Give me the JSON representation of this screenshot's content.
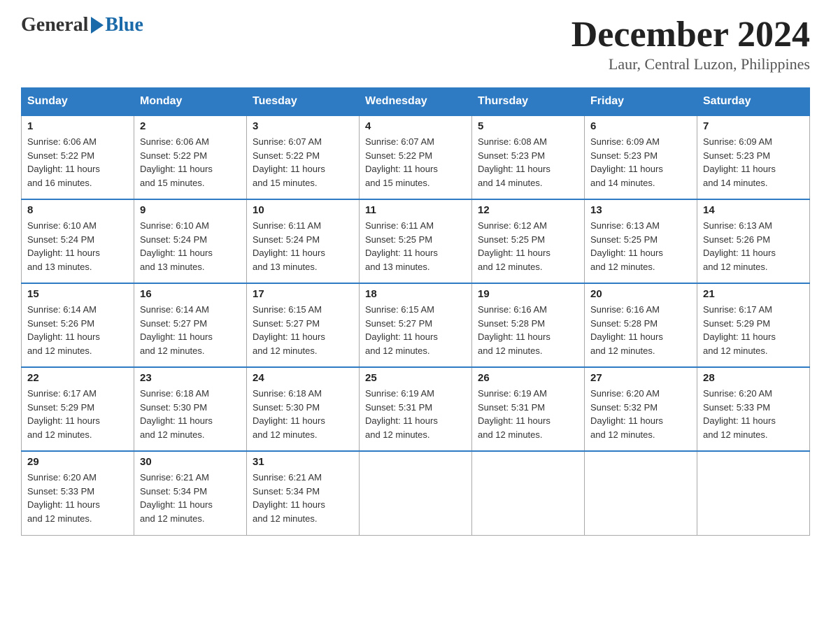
{
  "header": {
    "logo_general": "General",
    "logo_blue": "Blue",
    "month_title": "December 2024",
    "location": "Laur, Central Luzon, Philippines"
  },
  "days_of_week": [
    "Sunday",
    "Monday",
    "Tuesday",
    "Wednesday",
    "Thursday",
    "Friday",
    "Saturday"
  ],
  "weeks": [
    [
      {
        "day": "1",
        "sunrise": "6:06 AM",
        "sunset": "5:22 PM",
        "daylight": "11 hours and 16 minutes."
      },
      {
        "day": "2",
        "sunrise": "6:06 AM",
        "sunset": "5:22 PM",
        "daylight": "11 hours and 15 minutes."
      },
      {
        "day": "3",
        "sunrise": "6:07 AM",
        "sunset": "5:22 PM",
        "daylight": "11 hours and 15 minutes."
      },
      {
        "day": "4",
        "sunrise": "6:07 AM",
        "sunset": "5:22 PM",
        "daylight": "11 hours and 15 minutes."
      },
      {
        "day": "5",
        "sunrise": "6:08 AM",
        "sunset": "5:23 PM",
        "daylight": "11 hours and 14 minutes."
      },
      {
        "day": "6",
        "sunrise": "6:09 AM",
        "sunset": "5:23 PM",
        "daylight": "11 hours and 14 minutes."
      },
      {
        "day": "7",
        "sunrise": "6:09 AM",
        "sunset": "5:23 PM",
        "daylight": "11 hours and 14 minutes."
      }
    ],
    [
      {
        "day": "8",
        "sunrise": "6:10 AM",
        "sunset": "5:24 PM",
        "daylight": "11 hours and 13 minutes."
      },
      {
        "day": "9",
        "sunrise": "6:10 AM",
        "sunset": "5:24 PM",
        "daylight": "11 hours and 13 minutes."
      },
      {
        "day": "10",
        "sunrise": "6:11 AM",
        "sunset": "5:24 PM",
        "daylight": "11 hours and 13 minutes."
      },
      {
        "day": "11",
        "sunrise": "6:11 AM",
        "sunset": "5:25 PM",
        "daylight": "11 hours and 13 minutes."
      },
      {
        "day": "12",
        "sunrise": "6:12 AM",
        "sunset": "5:25 PM",
        "daylight": "11 hours and 12 minutes."
      },
      {
        "day": "13",
        "sunrise": "6:13 AM",
        "sunset": "5:25 PM",
        "daylight": "11 hours and 12 minutes."
      },
      {
        "day": "14",
        "sunrise": "6:13 AM",
        "sunset": "5:26 PM",
        "daylight": "11 hours and 12 minutes."
      }
    ],
    [
      {
        "day": "15",
        "sunrise": "6:14 AM",
        "sunset": "5:26 PM",
        "daylight": "11 hours and 12 minutes."
      },
      {
        "day": "16",
        "sunrise": "6:14 AM",
        "sunset": "5:27 PM",
        "daylight": "11 hours and 12 minutes."
      },
      {
        "day": "17",
        "sunrise": "6:15 AM",
        "sunset": "5:27 PM",
        "daylight": "11 hours and 12 minutes."
      },
      {
        "day": "18",
        "sunrise": "6:15 AM",
        "sunset": "5:27 PM",
        "daylight": "11 hours and 12 minutes."
      },
      {
        "day": "19",
        "sunrise": "6:16 AM",
        "sunset": "5:28 PM",
        "daylight": "11 hours and 12 minutes."
      },
      {
        "day": "20",
        "sunrise": "6:16 AM",
        "sunset": "5:28 PM",
        "daylight": "11 hours and 12 minutes."
      },
      {
        "day": "21",
        "sunrise": "6:17 AM",
        "sunset": "5:29 PM",
        "daylight": "11 hours and 12 minutes."
      }
    ],
    [
      {
        "day": "22",
        "sunrise": "6:17 AM",
        "sunset": "5:29 PM",
        "daylight": "11 hours and 12 minutes."
      },
      {
        "day": "23",
        "sunrise": "6:18 AM",
        "sunset": "5:30 PM",
        "daylight": "11 hours and 12 minutes."
      },
      {
        "day": "24",
        "sunrise": "6:18 AM",
        "sunset": "5:30 PM",
        "daylight": "11 hours and 12 minutes."
      },
      {
        "day": "25",
        "sunrise": "6:19 AM",
        "sunset": "5:31 PM",
        "daylight": "11 hours and 12 minutes."
      },
      {
        "day": "26",
        "sunrise": "6:19 AM",
        "sunset": "5:31 PM",
        "daylight": "11 hours and 12 minutes."
      },
      {
        "day": "27",
        "sunrise": "6:20 AM",
        "sunset": "5:32 PM",
        "daylight": "11 hours and 12 minutes."
      },
      {
        "day": "28",
        "sunrise": "6:20 AM",
        "sunset": "5:33 PM",
        "daylight": "11 hours and 12 minutes."
      }
    ],
    [
      {
        "day": "29",
        "sunrise": "6:20 AM",
        "sunset": "5:33 PM",
        "daylight": "11 hours and 12 minutes."
      },
      {
        "day": "30",
        "sunrise": "6:21 AM",
        "sunset": "5:34 PM",
        "daylight": "11 hours and 12 minutes."
      },
      {
        "day": "31",
        "sunrise": "6:21 AM",
        "sunset": "5:34 PM",
        "daylight": "11 hours and 12 minutes."
      },
      null,
      null,
      null,
      null
    ]
  ],
  "labels": {
    "sunrise": "Sunrise:",
    "sunset": "Sunset:",
    "daylight": "Daylight:"
  }
}
